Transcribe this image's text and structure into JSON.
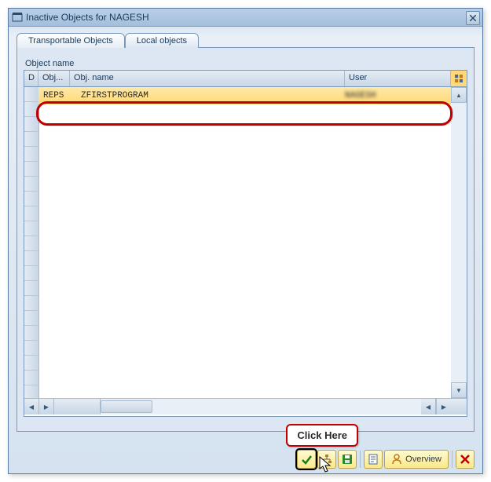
{
  "window": {
    "title": "Inactive Objects for NAGESH"
  },
  "tabs": {
    "transportable": "Transportable Objects",
    "local": "Local objects"
  },
  "section_label": "Object name",
  "columns": {
    "d": "D",
    "obj": "Obj...",
    "obj_name": "Obj. name",
    "user": "User"
  },
  "row": {
    "obj": "REPS",
    "obj_name": "ZFIRSTPROGRAM",
    "user": "NAGESH"
  },
  "callout": "Click Here",
  "footer": {
    "overview": "Overview"
  }
}
